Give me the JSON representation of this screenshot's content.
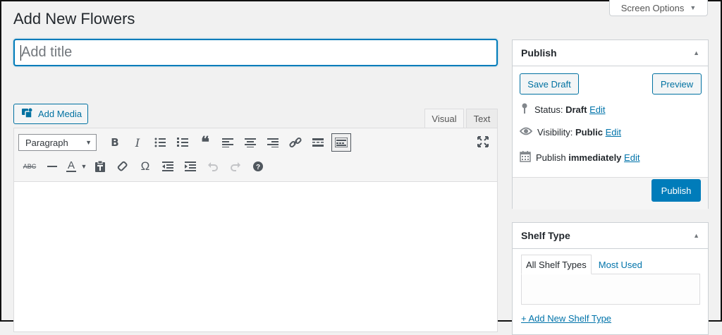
{
  "page": {
    "title": "Add New Flowers"
  },
  "screen_options": {
    "label": "Screen Options"
  },
  "title_field": {
    "placeholder": "Add title",
    "value": ""
  },
  "editor": {
    "add_media_label": "Add Media",
    "tabs": [
      {
        "label": "Visual",
        "active": true
      },
      {
        "label": "Text",
        "active": false
      }
    ],
    "format_select": {
      "value": "Paragraph"
    },
    "toolbar_row1_icons": [
      "bold-icon",
      "italic-icon",
      "bullet-list-icon",
      "numbered-list-icon",
      "blockquote-icon",
      "align-left-icon",
      "align-center-icon",
      "align-right-icon",
      "link-icon",
      "read-more-icon",
      "toolbar-toggle-icon"
    ],
    "toolbar_row2_icons": [
      "strikethrough-icon",
      "horizontal-line-icon",
      "text-color-icon",
      "paste-text-icon",
      "clear-formatting-icon",
      "special-character-icon",
      "outdent-icon",
      "indent-icon",
      "undo-icon",
      "redo-icon",
      "help-icon"
    ],
    "fullscreen_icon": "fullscreen-icon",
    "strike_label": "ABC",
    "text_color_label": "A",
    "bold_label": "B",
    "italic_label": "I",
    "omega_label": "Ω"
  },
  "publish_box": {
    "title": "Publish",
    "save_draft_label": "Save Draft",
    "preview_label": "Preview",
    "status": {
      "label": "Status:",
      "value": "Draft",
      "edit": "Edit"
    },
    "visibility": {
      "label": "Visibility:",
      "value": "Public",
      "edit": "Edit"
    },
    "schedule": {
      "label": "Publish",
      "value": "immediately",
      "edit": "Edit"
    },
    "publish_label": "Publish"
  },
  "shelf_box": {
    "title": "Shelf Type",
    "tabs": [
      {
        "label": "All Shelf Types",
        "active": true
      },
      {
        "label": "Most Used",
        "active": false
      }
    ],
    "add_new_label": "+ Add New Shelf Type"
  },
  "colors": {
    "accent": "#007cba",
    "link": "#0073aa",
    "background": "#f1f1f1"
  }
}
